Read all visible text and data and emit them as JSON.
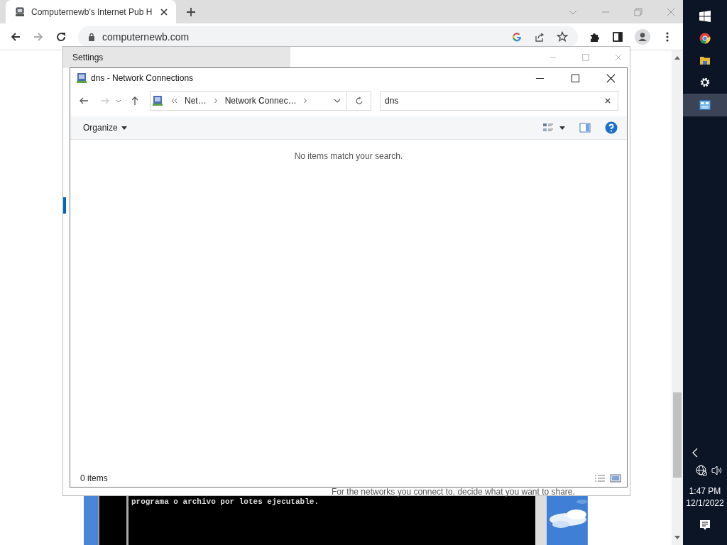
{
  "browser": {
    "tabs": [
      {
        "title": "Computernewb's Internet Pub H",
        "selected": true
      }
    ],
    "address": "computernewb.com"
  },
  "page": {
    "console_lines": [
      "programa o archivo por lotes ejecutable."
    ]
  },
  "settings_window": {
    "title": "Settings",
    "caption": "For the networks you connect to, decide what you want to share."
  },
  "explorer": {
    "title": "dns - Network Connections",
    "breadcrumb": [
      "Net…",
      "Network Connec…"
    ],
    "search": {
      "value": "dns"
    },
    "organize": "Organize",
    "message": "No items match your search.",
    "status": "0 items"
  },
  "taskbar": {
    "time": "1:47 PM",
    "date": "12/1/2022"
  }
}
